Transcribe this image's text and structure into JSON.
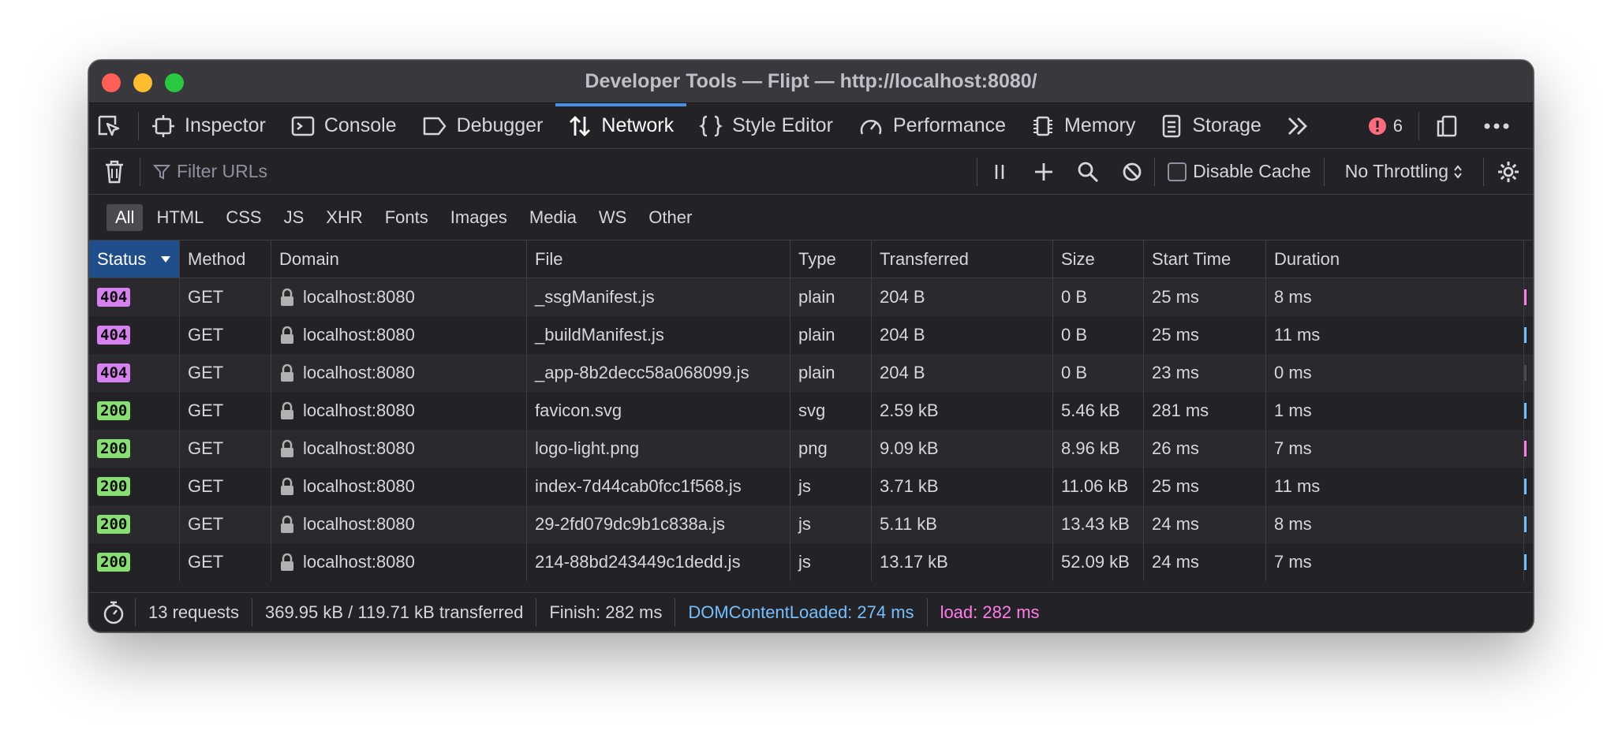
{
  "window": {
    "title": "Developer Tools — Flipt — http://localhost:8080/",
    "traffic_lights": [
      "#ff5f57",
      "#febc2e",
      "#28c840"
    ]
  },
  "toolbar": {
    "tabs": [
      {
        "label": "Inspector",
        "icon": "inspector-icon"
      },
      {
        "label": "Console",
        "icon": "console-icon"
      },
      {
        "label": "Debugger",
        "icon": "debugger-icon"
      },
      {
        "label": "Network",
        "icon": "network-icon",
        "active": true
      },
      {
        "label": "Style Editor",
        "icon": "style-editor-icon"
      },
      {
        "label": "Performance",
        "icon": "performance-icon"
      },
      {
        "label": "Memory",
        "icon": "memory-icon"
      },
      {
        "label": "Storage",
        "icon": "storage-icon"
      }
    ],
    "error_count": "6"
  },
  "filterbar": {
    "placeholder": "Filter URLs",
    "disable_cache_label": "Disable Cache",
    "throttling": "No Throttling"
  },
  "type_filters": [
    "All",
    "HTML",
    "CSS",
    "JS",
    "XHR",
    "Fonts",
    "Images",
    "Media",
    "WS",
    "Other"
  ],
  "columns": [
    "Status",
    "Method",
    "Domain",
    "File",
    "Type",
    "Transferred",
    "Size",
    "Start Time",
    "Duration"
  ],
  "rows": [
    {
      "status": "404",
      "method": "GET",
      "domain": "localhost:8080",
      "file": "_ssgManifest.js",
      "type": "plain",
      "transferred": "204 B",
      "size": "0 B",
      "start": "25 ms",
      "duration": "8 ms"
    },
    {
      "status": "404",
      "method": "GET",
      "domain": "localhost:8080",
      "file": "_buildManifest.js",
      "type": "plain",
      "transferred": "204 B",
      "size": "0 B",
      "start": "25 ms",
      "duration": "11 ms"
    },
    {
      "status": "404",
      "method": "GET",
      "domain": "localhost:8080",
      "file": "_app-8b2decc58a068099.js",
      "type": "plain",
      "transferred": "204 B",
      "size": "0 B",
      "start": "23 ms",
      "duration": "0 ms"
    },
    {
      "status": "200",
      "method": "GET",
      "domain": "localhost:8080",
      "file": "favicon.svg",
      "type": "svg",
      "transferred": "2.59 kB",
      "size": "5.46 kB",
      "start": "281 ms",
      "duration": "1 ms"
    },
    {
      "status": "200",
      "method": "GET",
      "domain": "localhost:8080",
      "file": "logo-light.png",
      "type": "png",
      "transferred": "9.09 kB",
      "size": "8.96 kB",
      "start": "26 ms",
      "duration": "7 ms"
    },
    {
      "status": "200",
      "method": "GET",
      "domain": "localhost:8080",
      "file": "index-7d44cab0fcc1f568.js",
      "type": "js",
      "transferred": "3.71 kB",
      "size": "11.06 kB",
      "start": "25 ms",
      "duration": "11 ms"
    },
    {
      "status": "200",
      "method": "GET",
      "domain": "localhost:8080",
      "file": "29-2fd079dc9b1c838a.js",
      "type": "js",
      "transferred": "5.11 kB",
      "size": "13.43 kB",
      "start": "24 ms",
      "duration": "8 ms"
    },
    {
      "status": "200",
      "method": "GET",
      "domain": "localhost:8080",
      "file": "214-88bd243449c1dedd.js",
      "type": "js",
      "transferred": "13.17 kB",
      "size": "52.09 kB",
      "start": "24 ms",
      "duration": "7 ms"
    }
  ],
  "colors": {
    "status_404": "#d781f0",
    "status_200": "#86de74",
    "dom_content_loaded": "#75bfff",
    "load": "#ff7de9",
    "accent": "#4a90e2"
  },
  "statusbar": {
    "requests": "13 requests",
    "transferred": "369.95 kB / 119.71 kB transferred",
    "finish": "Finish: 282 ms",
    "dom_content_loaded": "DOMContentLoaded: 274 ms",
    "load": "load: 282 ms"
  }
}
